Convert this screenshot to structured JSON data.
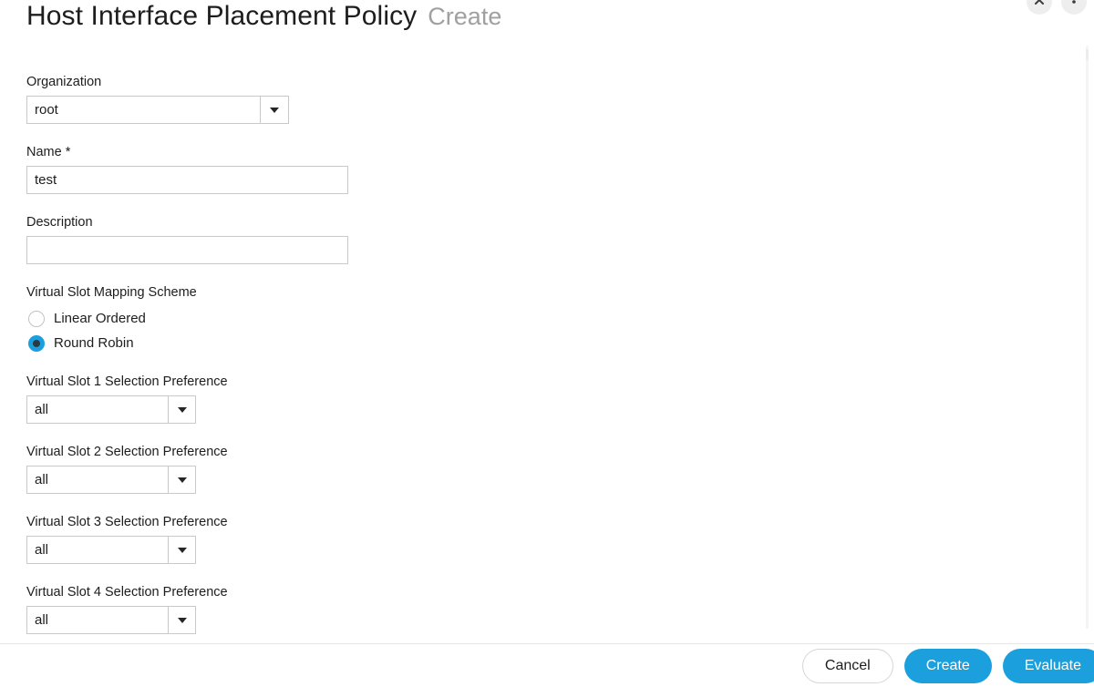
{
  "header": {
    "title": "Host Interface Placement Policy",
    "subtitle": "Create",
    "corner_buttons": [
      {
        "name": "collapse-up-button"
      },
      {
        "name": "options-button"
      }
    ]
  },
  "form": {
    "organization": {
      "label": "Organization",
      "value": "root"
    },
    "name": {
      "label": "Name *",
      "value": "test",
      "placeholder": ""
    },
    "description": {
      "label": "Description",
      "value": "",
      "placeholder": ""
    },
    "mapping_scheme": {
      "label": "Virtual Slot Mapping Scheme",
      "options": [
        {
          "label": "Linear Ordered",
          "selected": false
        },
        {
          "label": "Round Robin",
          "selected": true
        }
      ]
    },
    "slots": [
      {
        "label": "Virtual Slot 1 Selection Preference",
        "value": "all"
      },
      {
        "label": "Virtual Slot 2 Selection Preference",
        "value": "all"
      },
      {
        "label": "Virtual Slot 3 Selection Preference",
        "value": "all"
      },
      {
        "label": "Virtual Slot 4 Selection Preference",
        "value": "all"
      }
    ]
  },
  "footer": {
    "cancel_label": "Cancel",
    "create_label": "Create",
    "evaluate_label": "Evaluate"
  },
  "colors": {
    "accent": "#1ba0dd",
    "subtitle": "#a0a0a0",
    "border": "#c9c9c9",
    "radio_inner": "#2b3a42"
  }
}
